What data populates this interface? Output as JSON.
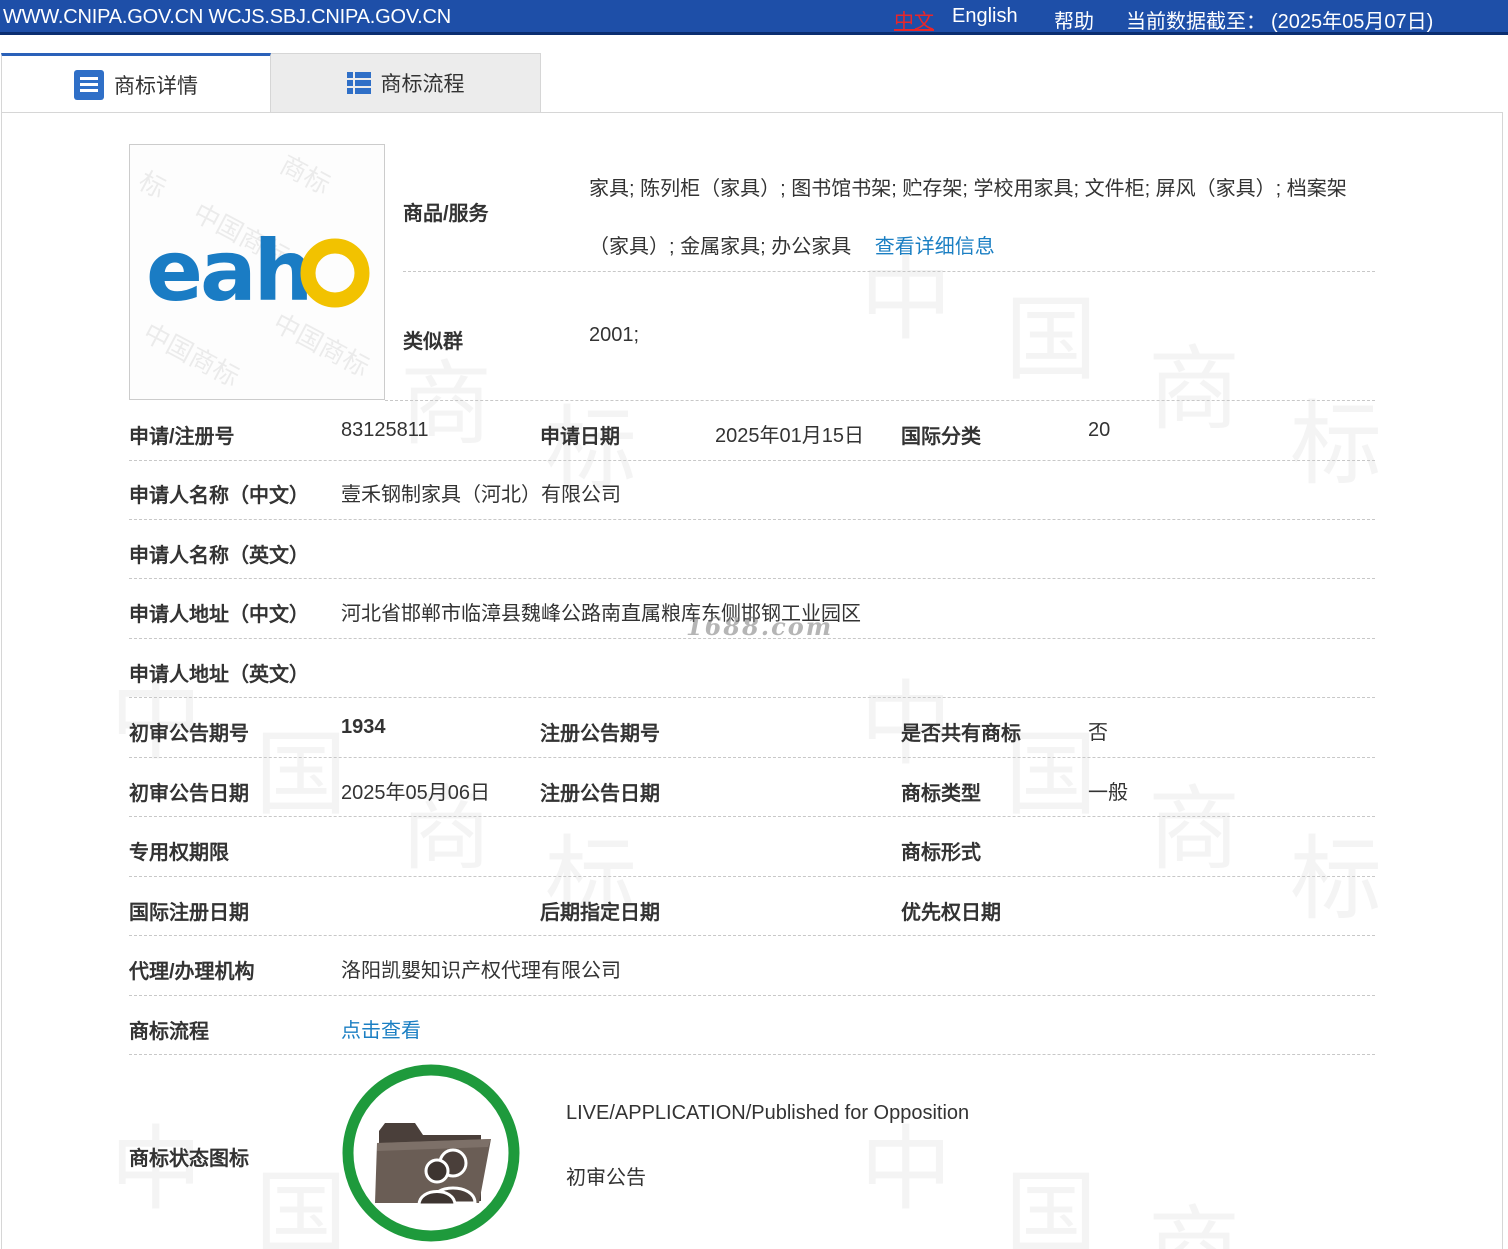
{
  "topbar": {
    "sites": "WWW.CNIPA.GOV.CN WCJS.SBJ.CNIPA.GOV.CN",
    "lang_zh": "中文",
    "lang_en": "English",
    "help": "帮助",
    "cutoff_label": "当前数据截至：",
    "cutoff_date": "(2025年05月07日)"
  },
  "tabs": [
    {
      "label": "商标详情",
      "active": true,
      "icon": "list-icon"
    },
    {
      "label": "商标流程",
      "active": false,
      "icon": "grid-list-icon"
    }
  ],
  "mark": {
    "text": "eaho",
    "colors": {
      "eah": "#1a7cc4",
      "o": "#f2c200"
    }
  },
  "goods": {
    "label": "商品/服务",
    "value": "家具; 陈列柜（家具）; 图书馆书架; 贮存架; 学校用家具; 文件柜; 屏风（家具）; 档案架（家具）; 金属家具; 办公家具",
    "more_link": "查看详细信息"
  },
  "similar_group": {
    "label": "类似群",
    "value": "2001;"
  },
  "fields": {
    "reg_no": {
      "label": "申请/注册号",
      "value": "83125811"
    },
    "app_date": {
      "label": "申请日期",
      "value": "2025年01月15日"
    },
    "intl_class": {
      "label": "国际分类",
      "value": "20"
    },
    "applicant_zh": {
      "label": "申请人名称（中文）",
      "value": "壹禾钢制家具（河北）有限公司"
    },
    "applicant_en": {
      "label": "申请人名称（英文）",
      "value": ""
    },
    "address_zh": {
      "label": "申请人地址（中文）",
      "value": "河北省邯郸市临漳县魏峰公路南直属粮库东侧邯钢工业园区"
    },
    "address_en": {
      "label": "申请人地址（英文）",
      "value": ""
    },
    "prelim_issue": {
      "label": "初审公告期号",
      "value": "1934"
    },
    "reg_issue": {
      "label": "注册公告期号",
      "value": ""
    },
    "shared": {
      "label": "是否共有商标",
      "value": "否"
    },
    "prelim_date": {
      "label": "初审公告日期",
      "value": "2025年05月06日"
    },
    "reg_date": {
      "label": "注册公告日期",
      "value": ""
    },
    "mark_type": {
      "label": "商标类型",
      "value": "一般"
    },
    "exclusive_term": {
      "label": "专用权期限",
      "value": ""
    },
    "mark_form": {
      "label": "商标形式",
      "value": ""
    },
    "intl_reg_date": {
      "label": "国际注册日期",
      "value": ""
    },
    "later_designation": {
      "label": "后期指定日期",
      "value": ""
    },
    "priority_date": {
      "label": "优先权日期",
      "value": ""
    },
    "agent": {
      "label": "代理/办理机构",
      "value": "洛阳凯嬰知识产权代理有限公司"
    },
    "process": {
      "label": "商标流程",
      "value": "点击查看"
    }
  },
  "status": {
    "label": "商标状态图标",
    "en": "LIVE/APPLICATION/Published for Opposition",
    "zh": "初审公告",
    "ring_color": "#1e9a3c"
  },
  "overlay_watermark": "1688.com"
}
